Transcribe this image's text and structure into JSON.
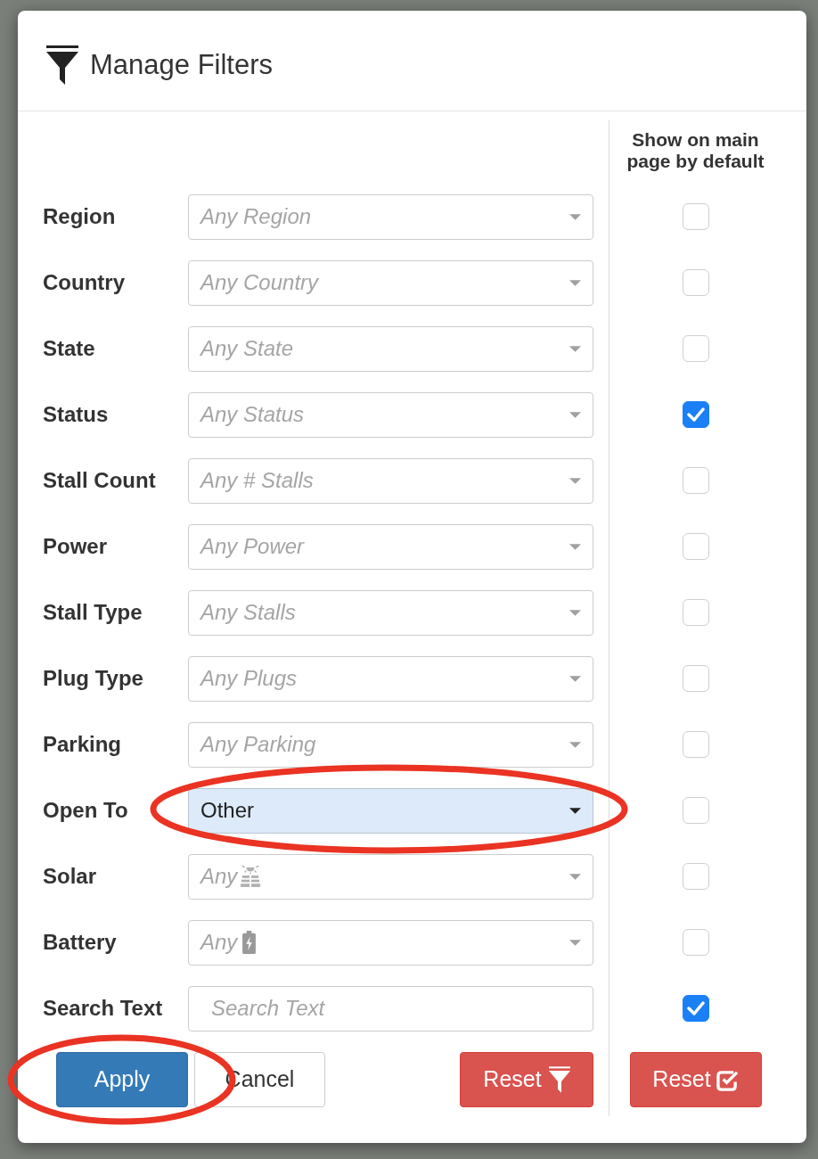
{
  "dialog": {
    "title": "Manage Filters",
    "column_heading": "Show on main page by default"
  },
  "filters": [
    {
      "label": "Region",
      "kind": "select",
      "placeholder": "Any Region",
      "checked": false,
      "circled": false
    },
    {
      "label": "Country",
      "kind": "select",
      "placeholder": "Any Country",
      "checked": false,
      "circled": false
    },
    {
      "label": "State",
      "kind": "select",
      "placeholder": "Any State",
      "checked": false,
      "circled": false
    },
    {
      "label": "Status",
      "kind": "select",
      "placeholder": "Any Status",
      "checked": true,
      "circled": false
    },
    {
      "label": "Stall Count",
      "kind": "select",
      "placeholder": "Any # Stalls",
      "checked": false,
      "circled": false
    },
    {
      "label": "Power",
      "kind": "select",
      "placeholder": "Any Power",
      "checked": false,
      "circled": false
    },
    {
      "label": "Stall Type",
      "kind": "select",
      "placeholder": "Any Stalls",
      "checked": false,
      "circled": false
    },
    {
      "label": "Plug Type",
      "kind": "select",
      "placeholder": "Any Plugs",
      "checked": false,
      "circled": false
    },
    {
      "label": "Parking",
      "kind": "select",
      "placeholder": "Any Parking",
      "checked": false,
      "circled": false
    },
    {
      "label": "Open To",
      "kind": "select",
      "value": "Other",
      "checked": false,
      "circled": true
    },
    {
      "label": "Solar",
      "kind": "solar",
      "placeholder": "Any",
      "checked": false,
      "circled": false
    },
    {
      "label": "Battery",
      "kind": "battery",
      "placeholder": "Any",
      "checked": false,
      "circled": false
    },
    {
      "label": "Search Text",
      "kind": "text",
      "placeholder": "Search Text",
      "checked": true,
      "circled": false
    }
  ],
  "buttons": [
    {
      "label": "Apply",
      "kind": "apply",
      "circled": true
    },
    {
      "label": "Cancel",
      "kind": "cancel",
      "circled": false
    },
    {
      "label": "Reset",
      "kind": "resetfilters",
      "circled": false
    },
    {
      "label": "Reset",
      "kind": "resetdefaults",
      "circled": false
    }
  ]
}
